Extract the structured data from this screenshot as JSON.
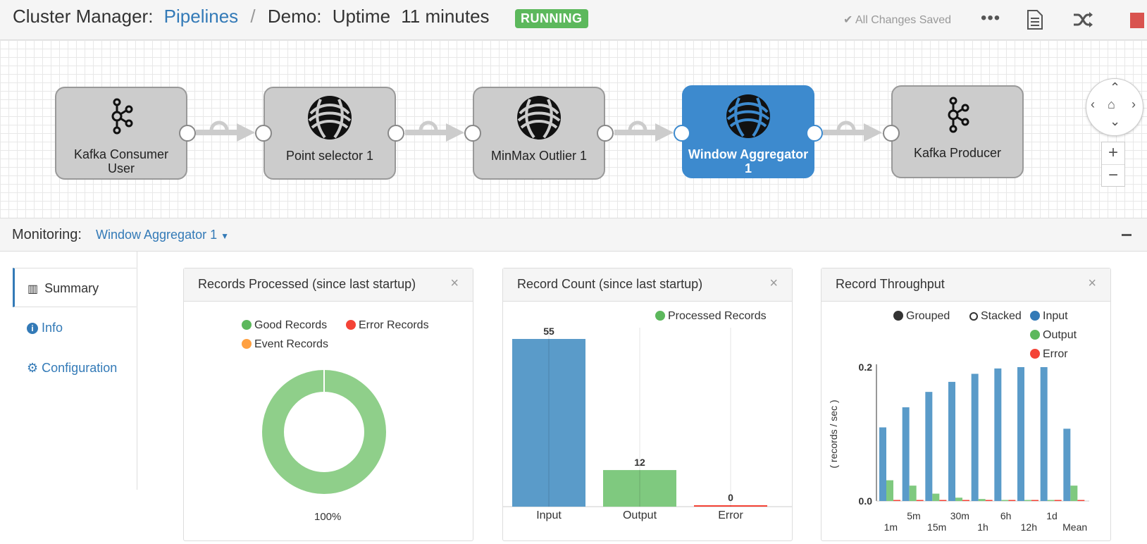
{
  "header": {
    "title_prefix": "Cluster Manager:",
    "breadcrumb_link": "Pipelines",
    "separator": "/",
    "pipeline_name": "Demo:",
    "uptime_label": "Uptime",
    "uptime_value": "11 minutes",
    "status_badge": "RUNNING",
    "saved_status": "All Changes Saved",
    "colors": {
      "running": "#5cb85c",
      "stop": "#d9534f",
      "link": "#337ab7"
    }
  },
  "canvas": {
    "nodes": [
      {
        "label": "Kafka Consumer User",
        "icon": "kafka-icon",
        "selected": false
      },
      {
        "label": "Point selector 1",
        "icon": "processor-icon",
        "selected": false
      },
      {
        "label": "MinMax Outlier 1",
        "icon": "processor-icon",
        "selected": false
      },
      {
        "label": "Window Aggregator 1",
        "icon": "processor-icon",
        "selected": true
      },
      {
        "label": "Kafka Producer",
        "icon": "kafka-icon",
        "selected": false
      }
    ],
    "selected_color": "#3d8ace"
  },
  "monitoring": {
    "label": "Monitoring:",
    "selected_stage": "Window Aggregator 1"
  },
  "side_tabs": [
    {
      "label": "Summary",
      "icon": "bar-chart-icon",
      "active": true
    },
    {
      "label": "Info",
      "icon": "info-icon",
      "active": false
    },
    {
      "label": "Configuration",
      "icon": "gear-icon",
      "active": false
    }
  ],
  "panels": {
    "records_processed": {
      "title": "Records Processed (since last startup)",
      "close": "×",
      "legend": [
        "Good Records",
        "Error Records",
        "Event Records"
      ],
      "legend_colors": [
        "#5cb85c",
        "#f44336",
        "#ffa040"
      ],
      "percent_label": "100%"
    },
    "record_count": {
      "title": "Record Count (since last startup)",
      "close": "×",
      "legend": "Processed Records"
    },
    "record_throughput": {
      "title": "Record Throughput",
      "close": "×",
      "legend": [
        "Grouped",
        "Stacked",
        "Input",
        "Output",
        "Error"
      ],
      "ylabel": "( records / sec )"
    }
  },
  "chart_data": [
    {
      "type": "pie",
      "title": "Records Processed (since last startup)",
      "categories": [
        "Good Records",
        "Error Records",
        "Event Records"
      ],
      "values": [
        100,
        0,
        0
      ],
      "colors": [
        "#8fcf8a",
        "#f44336",
        "#ffa040"
      ],
      "donut": true,
      "legend": "top"
    },
    {
      "type": "bar",
      "title": "Record Count (since last startup)",
      "categories": [
        "Input",
        "Output",
        "Error"
      ],
      "values": [
        55,
        12,
        0
      ],
      "colors": [
        "#5a9bc9",
        "#7fc97f",
        "#f44336"
      ],
      "ylim": [
        0,
        55
      ],
      "legend": "top-right",
      "series_name": "Processed Records"
    },
    {
      "type": "bar",
      "title": "Record Throughput",
      "ylabel": "( records / sec )",
      "categories": [
        "1m",
        "5m",
        "15m",
        "30m",
        "1h",
        "6h",
        "12h",
        "1d",
        "Mean"
      ],
      "series": [
        {
          "name": "Input",
          "color": "#5a9bc9",
          "values": [
            0.11,
            0.14,
            0.163,
            0.178,
            0.19,
            0.198,
            0.2,
            0.2,
            0.108
          ]
        },
        {
          "name": "Output",
          "color": "#7fc97f",
          "values": [
            0.031,
            0.023,
            0.011,
            0.005,
            0.003,
            0.001,
            0.0005,
            0.0005,
            0.023
          ]
        },
        {
          "name": "Error",
          "color": "#f44336",
          "values": [
            0,
            0,
            0,
            0,
            0,
            0,
            0,
            0,
            0
          ]
        }
      ],
      "ylim": [
        0,
        0.2
      ],
      "yticks": [
        "0.0",
        "0.2"
      ],
      "legend": "top-right"
    }
  ]
}
